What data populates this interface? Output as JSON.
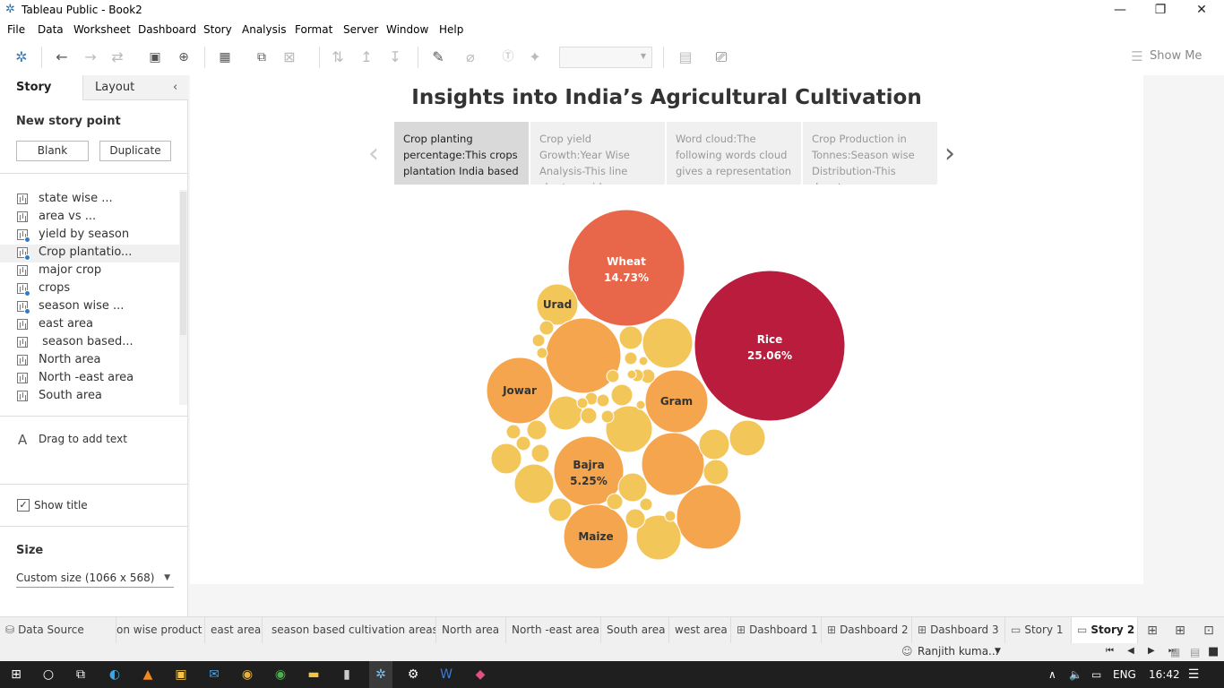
{
  "window": {
    "app_title": "Tableau Public - Book2",
    "minimize": "—",
    "restore": "❐",
    "close": "✕"
  },
  "menu": [
    "File",
    "Data",
    "Worksheet",
    "Dashboard",
    "Story",
    "Analysis",
    "Format",
    "Server",
    "Window",
    "Help"
  ],
  "toolbar": {
    "show_me": "Show Me"
  },
  "left_panel": {
    "tab_story": "Story",
    "tab_layout": "Layout",
    "new_story_point": "New story point",
    "blank_button": "Blank",
    "duplicate_button": "Duplicate",
    "sheets": [
      {
        "label": "state wise ...",
        "used": false
      },
      {
        "label": "area vs ...",
        "used": false
      },
      {
        "label": "yield by season",
        "used": true
      },
      {
        "label": "Crop plantatio...",
        "used": true
      },
      {
        "label": "major crop",
        "used": false
      },
      {
        "label": "crops",
        "used": true
      },
      {
        "label": "season wise ...",
        "used": true
      },
      {
        "label": "east area",
        "used": false
      },
      {
        "label": " season based...",
        "used": false
      },
      {
        "label": "North area",
        "used": false
      },
      {
        "label": "North -east area",
        "used": false
      },
      {
        "label": "South area",
        "used": false
      }
    ],
    "drag_text": "Drag to add text",
    "show_title": "Show title",
    "size_heading": "Size",
    "size_value": "Custom size (1066 x 568)"
  },
  "story": {
    "title": "Insights into India’s Agricultural Cultivation",
    "points": [
      {
        "text": "Crop planting percentage:This crops plantation India based",
        "active": true
      },
      {
        "text": "Crop yield Growth:Year Wise Analysis-This line chart provides a visual",
        "active": false
      },
      {
        "text": "Word cloud:The following words cloud gives a representation",
        "active": false
      },
      {
        "text": "Crop Production in Tonnes:Season wise Distribution-This donut",
        "active": false
      }
    ]
  },
  "bubbles": {
    "colors": {
      "rice": "#b91c3c",
      "wheat": "#e8664a",
      "mid": "#f5a54e",
      "small": "#f3c65a"
    },
    "labels": [
      {
        "name": "Rice",
        "value": "25.06%"
      },
      {
        "name": "Wheat",
        "value": "14.73%"
      },
      {
        "name": "Bajra",
        "value": "5.25%"
      },
      {
        "name": "Urad",
        "value": ""
      },
      {
        "name": "Jowar",
        "value": ""
      },
      {
        "name": "Gram",
        "value": ""
      },
      {
        "name": "Maize",
        "value": ""
      }
    ]
  },
  "bottom_tabs": [
    {
      "label": "Data Source",
      "icon": "datasource-icon",
      "glyph": "⛁"
    },
    {
      "label": "on wise product",
      "icon": "",
      "glyph": ""
    },
    {
      "label": "east area",
      "icon": "",
      "glyph": ""
    },
    {
      "label": "season based cultivation areas",
      "icon": "",
      "glyph": ""
    },
    {
      "label": "North area",
      "icon": "",
      "glyph": ""
    },
    {
      "label": "North -east area",
      "icon": "",
      "glyph": ""
    },
    {
      "label": "South area",
      "icon": "",
      "glyph": ""
    },
    {
      "label": "west area",
      "icon": "",
      "glyph": ""
    },
    {
      "label": "Dashboard 1",
      "icon": "dashboard-icon",
      "glyph": "⊞"
    },
    {
      "label": "Dashboard 2",
      "icon": "dashboard-icon",
      "glyph": "⊞"
    },
    {
      "label": "Dashboard 3",
      "icon": "dashboard-icon",
      "glyph": "⊞"
    },
    {
      "label": "Story 1",
      "icon": "story-icon",
      "glyph": "▭"
    },
    {
      "label": "Story 2",
      "icon": "story-icon",
      "glyph": "▭"
    }
  ],
  "status": {
    "user": "Ranjith kuma...",
    "nav": "⏮ ◀ ▶ ⏭"
  },
  "taskbar": {
    "language": "ENG",
    "time": "16:42"
  }
}
